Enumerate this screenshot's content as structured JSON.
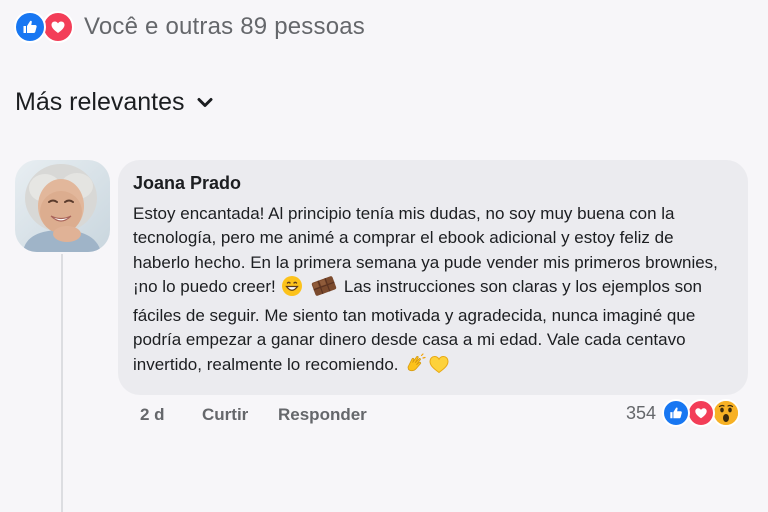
{
  "reactions_summary": {
    "text": "Você e outras 89 pessoas",
    "icons": [
      "like-icon",
      "love-icon"
    ]
  },
  "sort": {
    "label": "Más relevantes",
    "icon": "chevron-down-icon"
  },
  "comment": {
    "author": "Joana Prado",
    "text_part1": "Estoy encantada! Al principio tenía mis dudas, no soy muy buena con la tecnología, pero me animé a comprar el ebook adicional y estoy feliz de haberlo hecho. En la primera semana ya pude vender mis primeros brownies, ¡no lo puedo creer! ",
    "text_part2": " Las instrucciones son claras y los ejemplos son fáciles de seguir. Me siento tan motivada y agradecida, nunca imaginé que podría empezar a ganar dinero desde casa a mi edad. Vale cada centavo invertido, realmente lo recomiendo. ",
    "emojis": [
      "grinning-face-icon",
      "chocolate-bar-icon",
      "clapping-hands-icon",
      "yellow-heart-icon"
    ],
    "time": "2 d",
    "like_label": "Curtir",
    "reply_label": "Responder",
    "reaction_count": "354",
    "reaction_icons": [
      "like-icon",
      "love-icon",
      "wow-icon"
    ]
  },
  "colors": {
    "like": "#1877f2",
    "love": "#f33e58",
    "wow": "#f7b125",
    "secondary_text": "#65676b",
    "bubble": "#ebebef",
    "background": "#f7f6f9"
  }
}
